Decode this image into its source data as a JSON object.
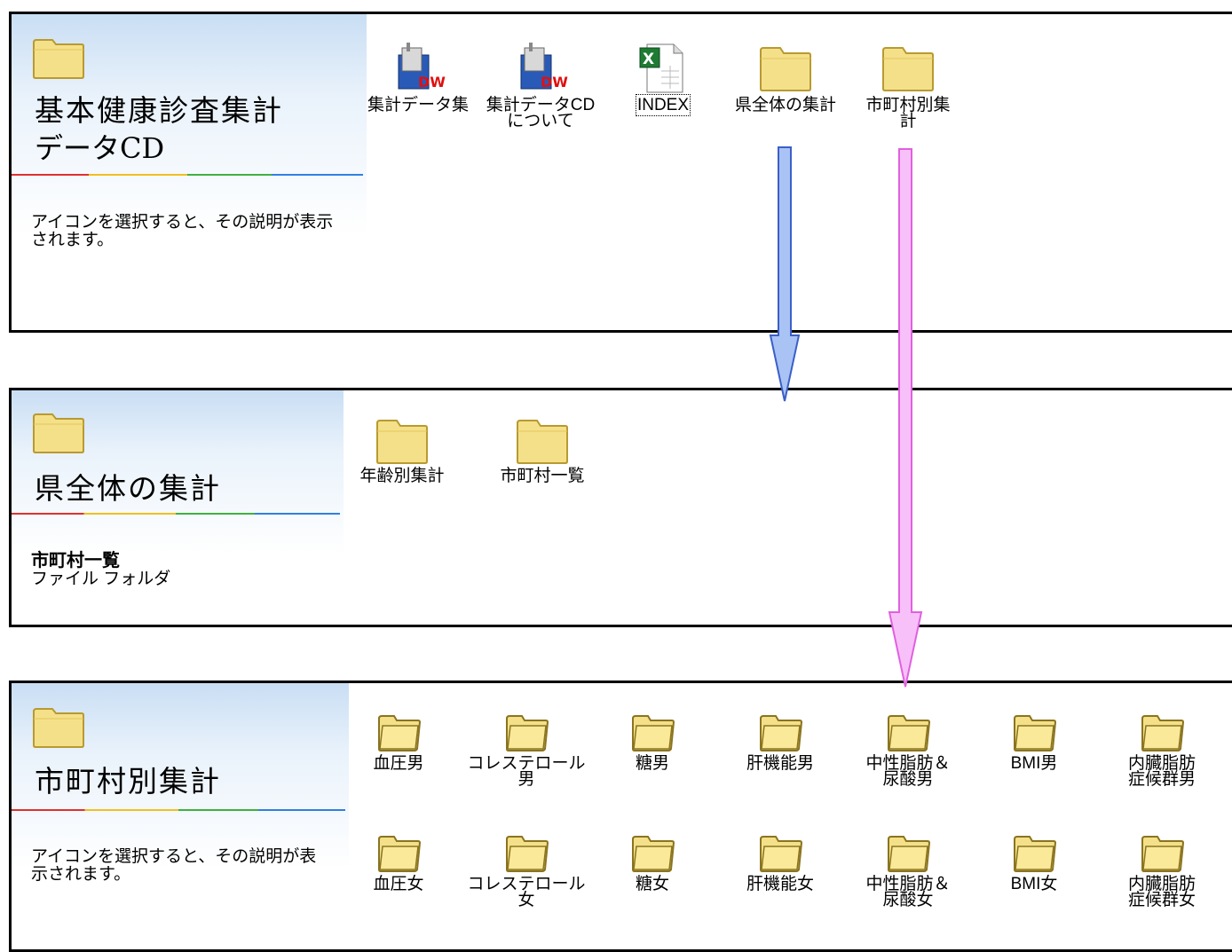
{
  "panel1": {
    "title_line1": "基本健康診査集計",
    "title_line2": "データCD",
    "description": "アイコンを選択すると、その説明が表示\nされます。",
    "items": [
      {
        "label": "集計データ集",
        "icon": "dreamweaver-doc-icon"
      },
      {
        "label": "集計データCD\nについて",
        "icon": "dreamweaver-doc-icon"
      },
      {
        "label": "INDEX",
        "icon": "excel-file-icon"
      },
      {
        "label": "県全体の集計",
        "icon": "folder-icon"
      },
      {
        "label": "市町村別集\n計",
        "icon": "folder-icon"
      }
    ]
  },
  "panel2": {
    "title": "県全体の集計",
    "selected_name": "市町村一覧",
    "selected_type": "ファイル フォルダ",
    "items": [
      {
        "label": "年齢別集計",
        "icon": "folder-icon"
      },
      {
        "label": "市町村一覧",
        "icon": "folder-icon"
      }
    ]
  },
  "panel3": {
    "title": "市町村別集計",
    "description": "アイコンを選択すると、その説明が表\n示されます。",
    "row1": [
      {
        "label": "血圧男"
      },
      {
        "label": "コレステロール男"
      },
      {
        "label": "糖男"
      },
      {
        "label": "肝機能男"
      },
      {
        "label": "中性脂肪＆\n尿酸男"
      },
      {
        "label": "BMI男"
      },
      {
        "label": "内臓脂肪\n症候群男"
      }
    ],
    "row2": [
      {
        "label": "血圧女"
      },
      {
        "label": "コレステロール女"
      },
      {
        "label": "糖女"
      },
      {
        "label": "肝機能女"
      },
      {
        "label": "中性脂肪＆\n尿酸女"
      },
      {
        "label": "BMI女"
      },
      {
        "label": "内臓脂肪\n症候群女"
      }
    ]
  },
  "colors": {
    "folder": "#f5e08a",
    "blue_arrow": "#a9c3f5",
    "pink_arrow": "#f8c0f8"
  }
}
